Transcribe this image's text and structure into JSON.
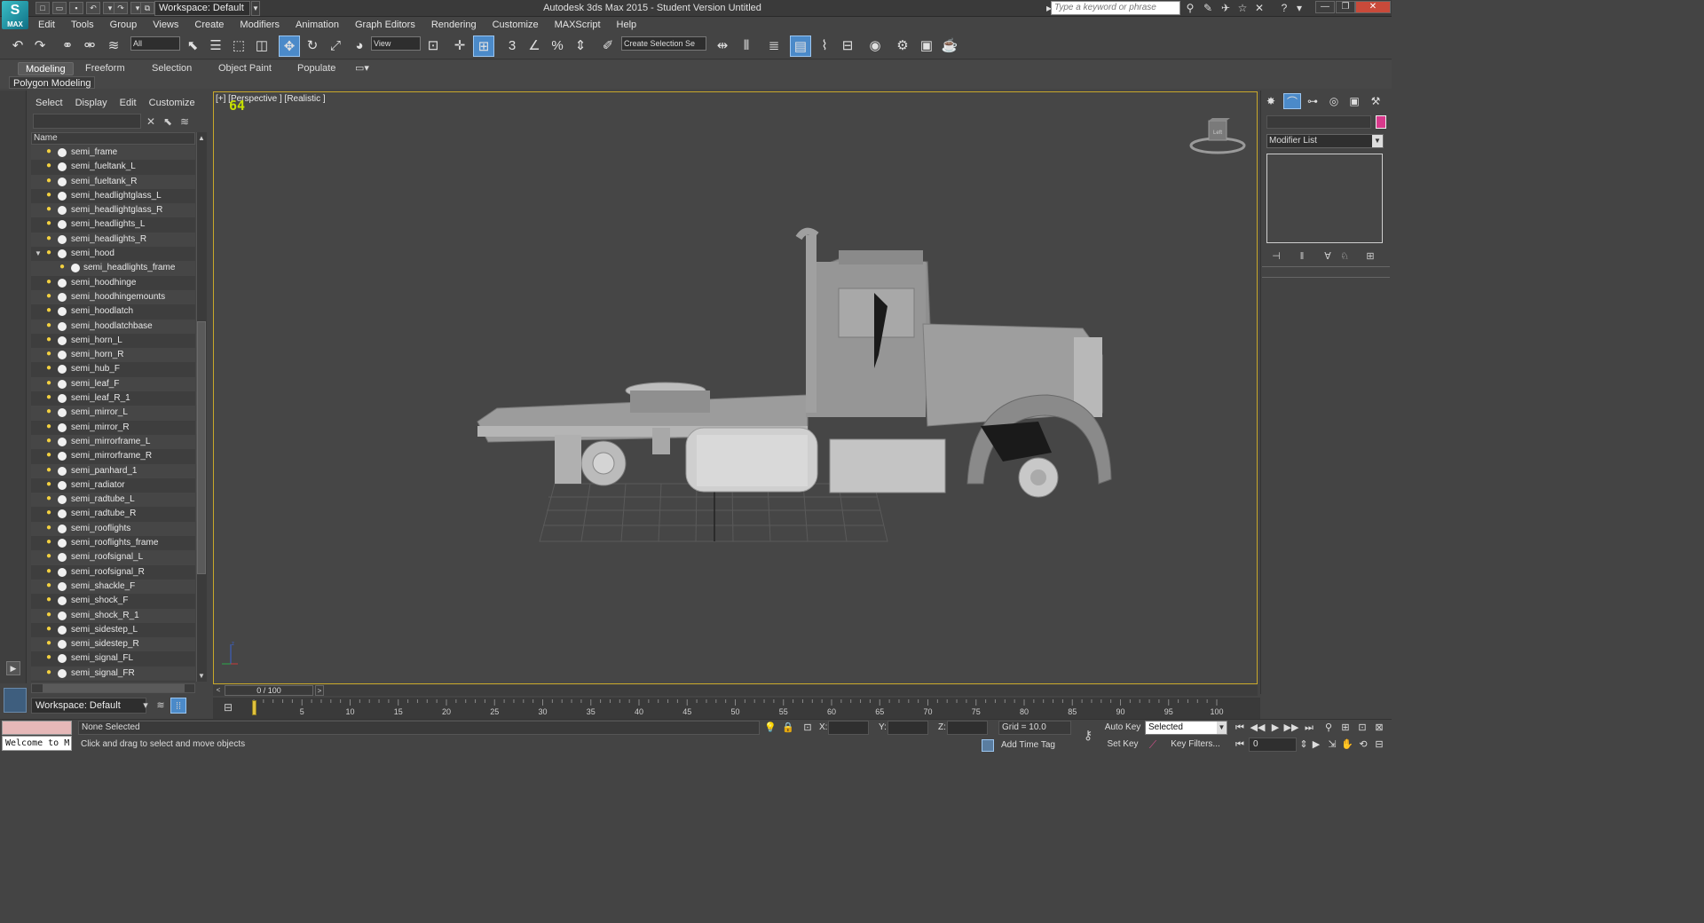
{
  "app": {
    "title": "Autodesk 3ds Max  2015    - Student Version    Untitled",
    "logo_text": "MAX",
    "workspace": "Workspace: Default",
    "search_placeholder": "Type a keyword or phrase"
  },
  "menu": [
    "Edit",
    "Tools",
    "Group",
    "Views",
    "Create",
    "Modifiers",
    "Animation",
    "Graph Editors",
    "Rendering",
    "Customize",
    "MAXScript",
    "Help"
  ],
  "toolbar": {
    "selection_filter": "All",
    "ref_coord": "View",
    "snap_label": "3",
    "named_selection": "Create Selection Se"
  },
  "ribbon": {
    "tabs": [
      "Modeling",
      "Freeform",
      "Selection",
      "Object Paint",
      "Populate"
    ],
    "active_tab": "Modeling",
    "panel_label": "Polygon Modeling"
  },
  "scene_explorer": {
    "menu": [
      "Select",
      "Display",
      "Edit",
      "Customize"
    ],
    "column_header": "Name",
    "items": [
      {
        "name": "semi_frame",
        "child": false
      },
      {
        "name": "semi_fueltank_L",
        "child": false
      },
      {
        "name": "semi_fueltank_R",
        "child": false
      },
      {
        "name": "semi_headlightglass_L",
        "child": false
      },
      {
        "name": "semi_headlightglass_R",
        "child": false
      },
      {
        "name": "semi_headlights_L",
        "child": false
      },
      {
        "name": "semi_headlights_R",
        "child": false
      },
      {
        "name": "semi_hood",
        "child": false,
        "expanded": true
      },
      {
        "name": "semi_headlights_frame",
        "child": true
      },
      {
        "name": "semi_hoodhinge",
        "child": false
      },
      {
        "name": "semi_hoodhingemounts",
        "child": false
      },
      {
        "name": "semi_hoodlatch",
        "child": false
      },
      {
        "name": "semi_hoodlatchbase",
        "child": false
      },
      {
        "name": "semi_horn_L",
        "child": false
      },
      {
        "name": "semi_horn_R",
        "child": false
      },
      {
        "name": "semi_hub_F",
        "child": false
      },
      {
        "name": "semi_leaf_F",
        "child": false
      },
      {
        "name": "semi_leaf_R_1",
        "child": false
      },
      {
        "name": "semi_mirror_L",
        "child": false
      },
      {
        "name": "semi_mirror_R",
        "child": false
      },
      {
        "name": "semi_mirrorframe_L",
        "child": false
      },
      {
        "name": "semi_mirrorframe_R",
        "child": false
      },
      {
        "name": "semi_panhard_1",
        "child": false
      },
      {
        "name": "semi_radiator",
        "child": false
      },
      {
        "name": "semi_radtube_L",
        "child": false
      },
      {
        "name": "semi_radtube_R",
        "child": false
      },
      {
        "name": "semi_rooflights",
        "child": false
      },
      {
        "name": "semi_rooflights_frame",
        "child": false
      },
      {
        "name": "semi_roofsignal_L",
        "child": false
      },
      {
        "name": "semi_roofsignal_R",
        "child": false
      },
      {
        "name": "semi_shackle_F",
        "child": false
      },
      {
        "name": "semi_shock_F",
        "child": false
      },
      {
        "name": "semi_shock_R_1",
        "child": false
      },
      {
        "name": "semi_sidestep_L",
        "child": false
      },
      {
        "name": "semi_sidestep_R",
        "child": false
      },
      {
        "name": "semi_signal_FL",
        "child": false
      },
      {
        "name": "semi_signal_FR",
        "child": false
      }
    ],
    "workspace_bottom": "Workspace: Default"
  },
  "viewport": {
    "label": "[+] [Perspective ] [Realistic ]",
    "fps": "64",
    "viewcube_face": "Left"
  },
  "command_panel": {
    "modifier_list": "Modifier List",
    "object_color": "#d83a8c"
  },
  "timeline": {
    "slider": "0 / 100",
    "ticks": [
      "5",
      "10",
      "15",
      "20",
      "25",
      "30",
      "35",
      "40",
      "45",
      "50",
      "55",
      "60",
      "65",
      "70",
      "75",
      "80",
      "85",
      "90",
      "95",
      "100"
    ]
  },
  "status": {
    "maxscript_line": "Welcome to M",
    "selection": "None Selected",
    "prompt": "Click and drag to select and move objects",
    "x_label": "X:",
    "y_label": "Y:",
    "z_label": "Z:",
    "grid": "Grid = 10.0",
    "add_time_tag": "Add Time Tag",
    "auto_key": "Auto Key",
    "set_key": "Set Key",
    "key_mode": "Selected",
    "key_filters": "Key Filters...",
    "current_frame": "0"
  },
  "colors": {
    "accent": "#4b8ac9",
    "viewport_border": "#c8a82a",
    "fps": "#c6e000",
    "bulb": "#f2d040"
  }
}
